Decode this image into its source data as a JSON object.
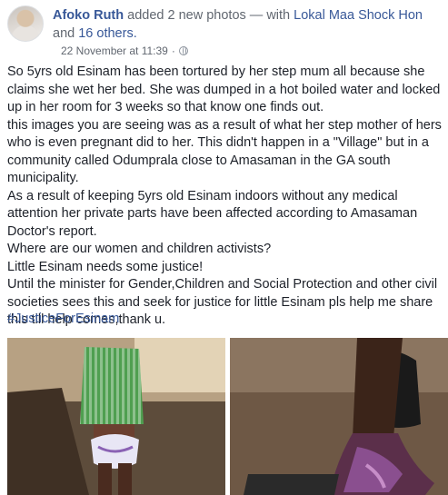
{
  "post": {
    "author": "Afoko Ruth",
    "action": " added 2 new photos — with ",
    "tagged": "Lokal Maa Shock Hon",
    "and_text": " and ",
    "others": "16 others.",
    "timestamp": "22 November at 11:39",
    "separator": " · ",
    "privacy_icon": "globe-icon",
    "paragraphs": [
      "So 5yrs old Esinam has been tortured by her step mum all because she claims she wet her bed. She was dumped in a hot boiled water and locked up in her room for 3 weeks so that know one finds out.",
      "this images you are seeing was as a result of what her step mother of hers who is even pregnant did to her. This didn't happen in a \"Village\" but in a community called Odumprala close to Amasaman in the GA south municipality.",
      "As a result of keeping 5yrs old Esinam indoors without any medical attention her private parts have been affected according to Amasaman Doctor's report.",
      "Where are our women and children activists?",
      "Little Esinam needs some justice!",
      "Until the minister for Gender,Children and Social Protection and other civil societies sees this and seek for justice for little Esinam pls help me share this till help comes,thank u."
    ],
    "hashtag": "#JusticeForEsinam",
    "colors": {
      "link": "#385898",
      "meta": "#616770",
      "text": "#1d2129"
    }
  }
}
